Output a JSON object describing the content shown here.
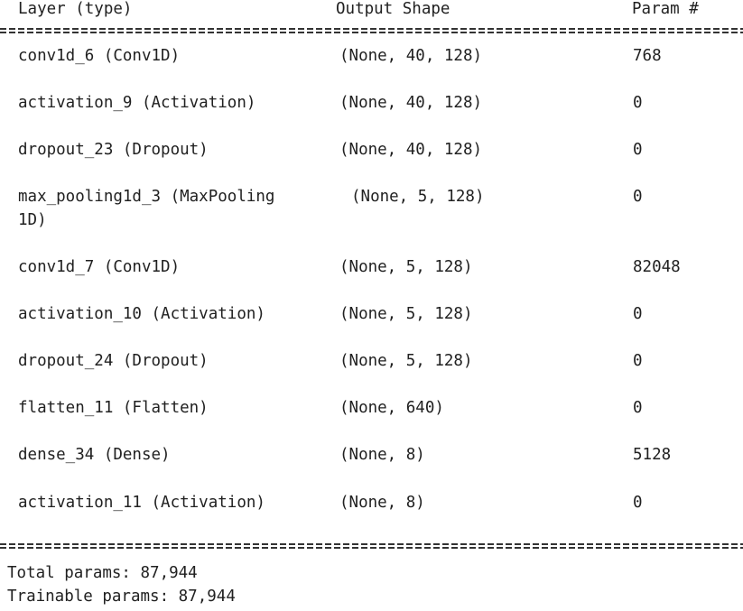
{
  "header": {
    "layer_col": "Layer (type)",
    "shape_col": "Output Shape",
    "param_col": "Param #"
  },
  "rows": [
    {
      "layer": "conv1d_6 (Conv1D)",
      "shape": "(None, 40, 128)",
      "params": "768"
    },
    {
      "layer": "activation_9 (Activation)",
      "shape": "(None, 40, 128)",
      "params": "0"
    },
    {
      "layer": "dropout_23 (Dropout)",
      "shape": "(None, 40, 128)",
      "params": "0"
    },
    {
      "layer": "max_pooling1d_3 (MaxPooling",
      "layer_cont": "1D)",
      "shape": "(None, 5, 128)",
      "params": "0"
    },
    {
      "layer": "conv1d_7 (Conv1D)",
      "shape": "(None, 5, 128)",
      "params": "82048"
    },
    {
      "layer": "activation_10 (Activation)",
      "shape": "(None, 5, 128)",
      "params": "0"
    },
    {
      "layer": "dropout_24 (Dropout)",
      "shape": "(None, 5, 128)",
      "params": "0"
    },
    {
      "layer": "flatten_11 (Flatten)",
      "shape": "(None, 640)",
      "params": "0"
    },
    {
      "layer": "dense_34 (Dense)",
      "shape": "(None, 8)",
      "params": "5128"
    },
    {
      "layer": "activation_11 (Activation)",
      "shape": "(None, 8)",
      "params": "0"
    }
  ],
  "summary": {
    "total": "Total params: 87,944",
    "trainable": "Trainable params: 87,944"
  }
}
